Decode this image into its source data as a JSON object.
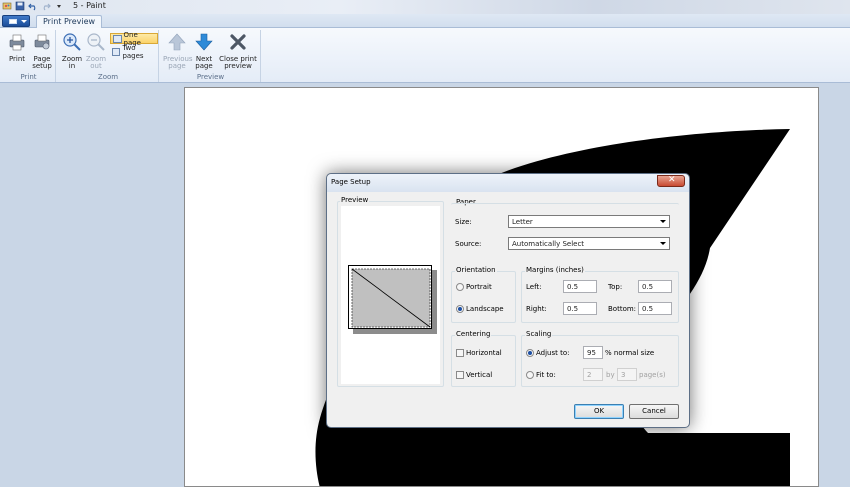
{
  "window": {
    "title": "5 - Paint"
  },
  "ribbon": {
    "tab": "Print Preview",
    "groups": {
      "print": {
        "label": "Print",
        "print_button": "Print",
        "page_setup_line1": "Page",
        "page_setup_line2": "setup"
      },
      "zoom": {
        "label": "Zoom",
        "zoom_in_line1": "Zoom",
        "zoom_in_line2": "in",
        "zoom_out_line1": "Zoom",
        "zoom_out_line2": "out",
        "one_page": "One page",
        "two_pages": "Two pages"
      },
      "preview": {
        "label": "Preview",
        "previous_line1": "Previous",
        "previous_line2": "page",
        "next_line1": "Next",
        "next_line2": "page",
        "close_line1": "Close print",
        "close_line2": "preview"
      }
    }
  },
  "dialog": {
    "title": "Page Setup",
    "preview_label": "Preview",
    "paper": {
      "group_label": "Paper",
      "size_label": "Size:",
      "size_value": "Letter",
      "source_label": "Source:",
      "source_value": "Automatically Select"
    },
    "orientation": {
      "group_label": "Orientation",
      "portrait": "Portrait",
      "landscape": "Landscape",
      "selected": "landscape"
    },
    "margins": {
      "group_label": "Margins (inches)",
      "left_label": "Left:",
      "left_value": "0.5",
      "top_label": "Top:",
      "top_value": "0.5",
      "right_label": "Right:",
      "right_value": "0.5",
      "bottom_label": "Bottom:",
      "bottom_value": "0.5"
    },
    "centering": {
      "group_label": "Centering",
      "horizontal": "Horizontal",
      "vertical": "Vertical"
    },
    "scaling": {
      "group_label": "Scaling",
      "adjust_label": "Adjust to:",
      "adjust_value": "95",
      "adjust_suffix": "% normal size",
      "fit_label": "Fit to:",
      "fit_wide": "2",
      "fit_by": "by",
      "fit_tall": "3",
      "fit_suffix": "page(s)"
    },
    "ok": "OK",
    "cancel": "Cancel"
  },
  "colors": {
    "accent": "#1c4e9a",
    "close_red": "#c84a31",
    "workspace": "#c9d6e6"
  }
}
